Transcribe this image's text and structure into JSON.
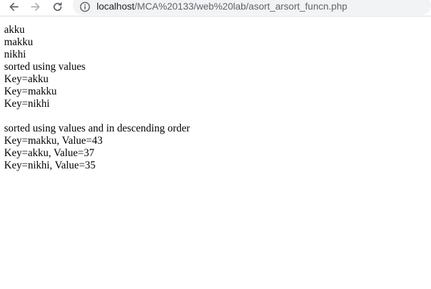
{
  "browser": {
    "url_host": "localhost",
    "url_path": "/MCA%20133/web%20lab/asort_arsort_funcn.php",
    "icons": {
      "back": "back-arrow-icon",
      "forward": "forward-arrow-icon",
      "reload": "reload-icon",
      "info": "info-icon"
    }
  },
  "page": {
    "names": [
      "akku",
      "makku",
      "nikhi"
    ],
    "asc_heading": "sorted using values",
    "asc_lines": [
      "Key=akku",
      "Key=makku",
      "Key=nikhi"
    ],
    "desc_heading": "sorted using values and in descending order",
    "desc_lines": [
      "Key=makku, Value=43",
      "Key=akku, Value=37",
      "Key=nikhi, Value=35"
    ]
  }
}
